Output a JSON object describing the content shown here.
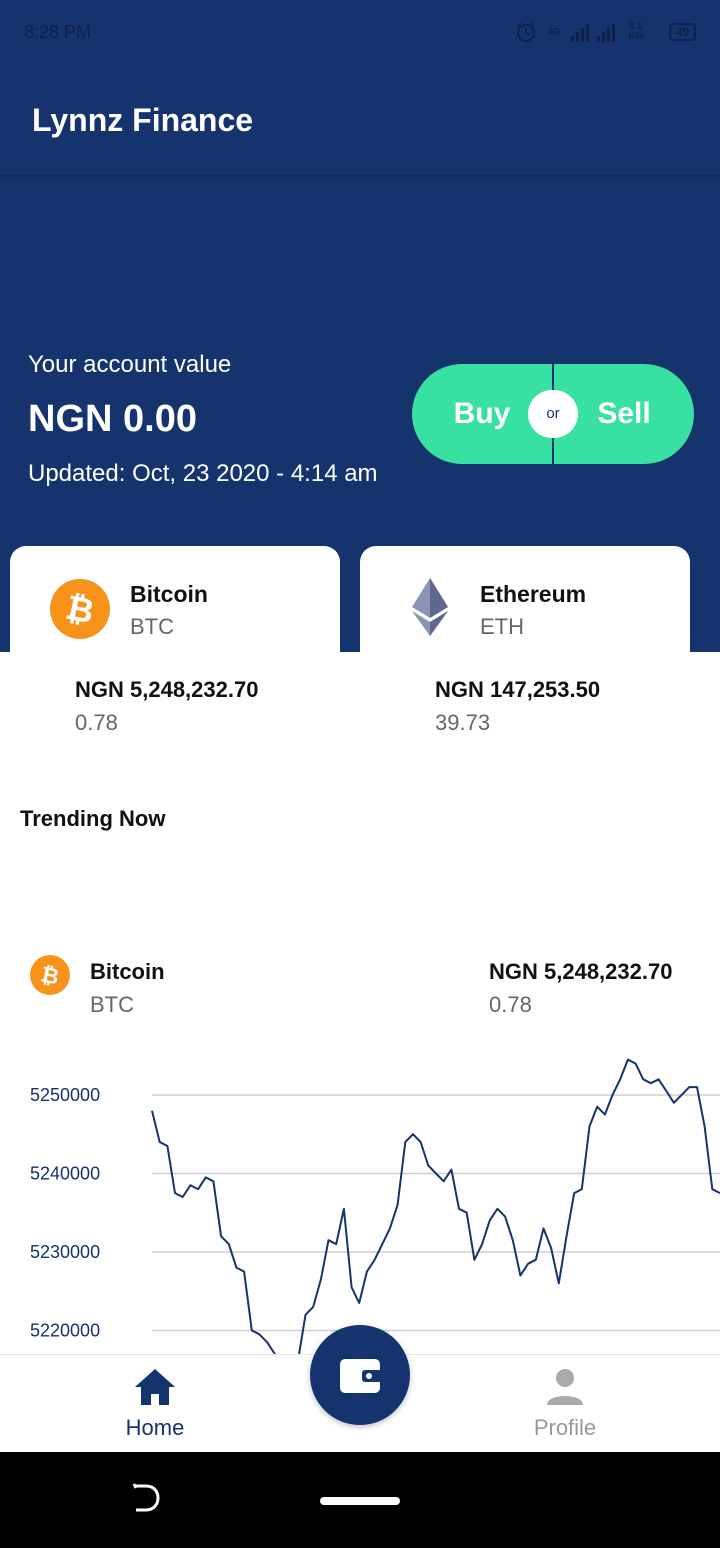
{
  "status_bar": {
    "time": "8:28 PM",
    "network": "4G",
    "speed": "5.1 K/s",
    "battery": "49"
  },
  "app": {
    "title": "Lynnz Finance"
  },
  "account": {
    "label": "Your account value",
    "value": "NGN 0.00",
    "updated": "Updated: Oct, 23 2020 - 4:14 am"
  },
  "trade": {
    "buy_label": "Buy",
    "or_label": "or",
    "sell_label": "Sell"
  },
  "assets": [
    {
      "name": "Bitcoin",
      "symbol": "BTC",
      "value": "NGN 5,248,232.70",
      "amount": "0.78",
      "icon": "bitcoin-icon",
      "color": "#f7931a"
    },
    {
      "name": "Ethereum",
      "symbol": "ETH",
      "value": "NGN 147,253.50",
      "amount": "39.73",
      "icon": "ethereum-icon",
      "color": "#627eea"
    }
  ],
  "trending": {
    "title": "Trending Now",
    "item": {
      "name": "Bitcoin",
      "symbol": "BTC",
      "value": "NGN 5,248,232.70",
      "amount": "0.78",
      "icon": "bitcoin-icon"
    }
  },
  "chart_data": {
    "type": "line",
    "ylim": [
      5217000,
      5257000
    ],
    "yticks": [
      5250000,
      5240000,
      5230000,
      5220000
    ],
    "tick_labels": [
      "5250000",
      "5240000",
      "5230000",
      "5220000"
    ],
    "grid": true,
    "series": [
      {
        "values": [
          5248000,
          5244000,
          5243500,
          5237500,
          5237000,
          5238500,
          5238000,
          5239500,
          5239000,
          5232000,
          5231000,
          5228000,
          5227500,
          5220000,
          5219500,
          5218500,
          5217000,
          5214000,
          5215000,
          5216000,
          5222000,
          5223000,
          5226500,
          5231500,
          5231000,
          5235500,
          5225500,
          5223500,
          5227500,
          5229000,
          5231000,
          5233000,
          5236000,
          5244000,
          5245000,
          5244000,
          5241000,
          5240000,
          5239000,
          5240500,
          5235500,
          5235000,
          5229000,
          5231000,
          5234000,
          5235500,
          5234500,
          5231500,
          5227000,
          5228500,
          5229000,
          5233000,
          5230500,
          5226000,
          5232000,
          5237500,
          5238000,
          5246000,
          5248500,
          5247500,
          5250000,
          5252000,
          5254500,
          5254000,
          5252000,
          5251500,
          5252000,
          5250500,
          5249000,
          5250000,
          5251000,
          5251000,
          5246000,
          5238000,
          5237500
        ]
      }
    ],
    "line_color": "#15336d"
  },
  "bottom_nav": {
    "home_label": "Home",
    "profile_label": "Profile",
    "home_icon": "home-icon",
    "wallet_icon": "wallet-icon",
    "profile_icon": "person-icon"
  },
  "colors": {
    "primary": "#15336d",
    "accent": "#38e0a1"
  }
}
